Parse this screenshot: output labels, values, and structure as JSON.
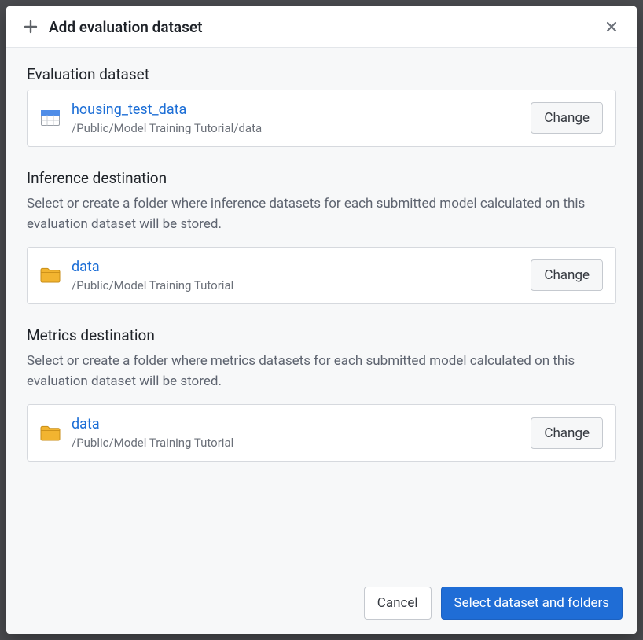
{
  "header": {
    "title": "Add evaluation dataset"
  },
  "sections": {
    "evaluation": {
      "title": "Evaluation dataset",
      "item": {
        "name": "housing_test_data",
        "path": "/Public/Model Training Tutorial/data",
        "change_label": "Change"
      }
    },
    "inference": {
      "title": "Inference destination",
      "desc": "Select or create a folder where inference datasets for each submitted model calculated on this evaluation dataset will be stored.",
      "item": {
        "name": "data",
        "path": "/Public/Model Training Tutorial",
        "change_label": "Change"
      }
    },
    "metrics": {
      "title": "Metrics destination",
      "desc": "Select or create a folder where metrics datasets for each submitted model calculated on this evaluation dataset will be stored.",
      "item": {
        "name": "data",
        "path": "/Public/Model Training Tutorial",
        "change_label": "Change"
      }
    }
  },
  "footer": {
    "cancel_label": "Cancel",
    "primary_label": "Select dataset and folders"
  }
}
